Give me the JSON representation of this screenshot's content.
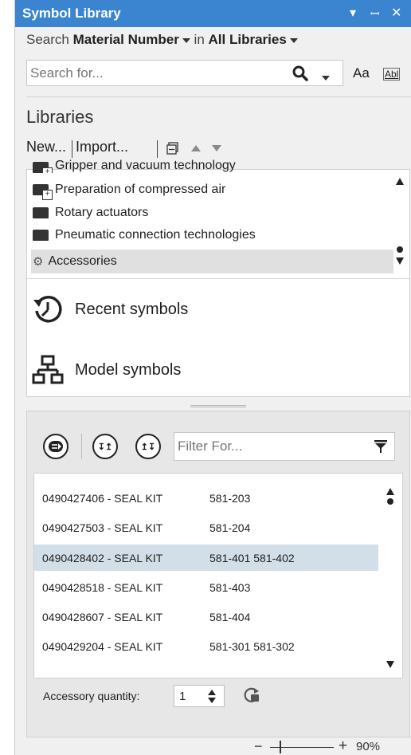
{
  "window": {
    "title": "Symbol Library",
    "controls": [
      "▾",
      "ꟷ",
      "✕"
    ]
  },
  "search": {
    "prefix": "Search",
    "field": "Material Number",
    "in_word": "in",
    "scope": "All Libraries",
    "placeholder": "Search for...",
    "match_case_label": "Aa",
    "whole_word_label": "Abl"
  },
  "libraries": {
    "heading": "Libraries",
    "toolbar": {
      "new_label": "New...",
      "import_label": "Import..."
    },
    "items": [
      {
        "label": "Gripper and vacuum technology",
        "icon": "folder-plus-icon"
      },
      {
        "label": "Preparation of compressed air",
        "icon": "folder-plus-icon"
      },
      {
        "label": "Rotary actuators",
        "icon": "folder-icon"
      },
      {
        "label": "Pneumatic connection technologies",
        "icon": "folder-icon"
      },
      {
        "label": "Accessories",
        "icon": "accessories-icon",
        "selected": true
      }
    ],
    "recent_label": "Recent symbols",
    "model_label": "Model symbols"
  },
  "symbols": {
    "filter_placeholder": "Filter For...",
    "rows": [
      {
        "name": "0490427406 - SEAL KIT",
        "codes": "581-203"
      },
      {
        "name": "0490427503 - SEAL KIT",
        "codes": "581-204"
      },
      {
        "name": "0490428402 - SEAL KIT",
        "codes": "581-401 581-402",
        "selected": true
      },
      {
        "name": "0490428518 - SEAL KIT",
        "codes": "581-403"
      },
      {
        "name": "0490428607 - SEAL KIT",
        "codes": "581-404"
      },
      {
        "name": "0490429204 - SEAL KIT",
        "codes": "581-301 581-302"
      }
    ],
    "quantity_label": "Accessory quantity:",
    "quantity_value": "1"
  },
  "zoom": {
    "percent": "90%"
  },
  "colors": {
    "titlebar": "#3a84d0",
    "selected_row": "#d2dfe8",
    "selected_lib": "#e0e0e0"
  }
}
